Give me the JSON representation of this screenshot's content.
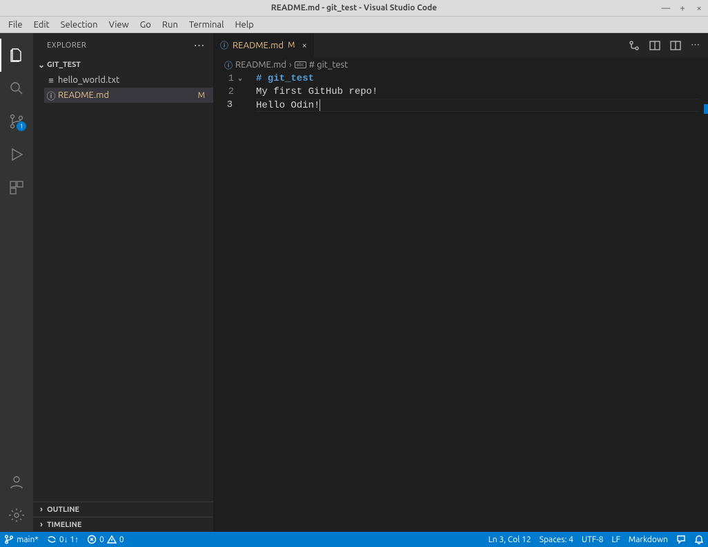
{
  "window": {
    "title": "README.md - git_test - Visual Studio Code"
  },
  "menu": {
    "items": [
      "File",
      "Edit",
      "Selection",
      "View",
      "Go",
      "Run",
      "Terminal",
      "Help"
    ]
  },
  "activity": {
    "scm_badge": "1"
  },
  "sidebar": {
    "title": "EXPLORER",
    "project": "GIT_TEST",
    "files": [
      {
        "icon": "≡",
        "name": "hello_world.txt",
        "modified": false,
        "selected": false
      },
      {
        "icon": "ⓘ",
        "name": "README.md",
        "modified": true,
        "selected": true,
        "status": "M"
      }
    ],
    "outline": "OUTLINE",
    "timeline": "TIMELINE"
  },
  "tab": {
    "name": "README.md",
    "status": "M",
    "close": "×"
  },
  "breadcrumb": {
    "file": "README.md",
    "sep": "›",
    "symbol": "# git_test"
  },
  "editor": {
    "lines": [
      {
        "n": "1",
        "cls": "md-h",
        "text": "# git_test",
        "fold": "⌄"
      },
      {
        "n": "2",
        "cls": "md-text",
        "text": "My first GitHub repo!"
      },
      {
        "n": "3",
        "cls": "md-text",
        "text": "Hello Odin!",
        "cursor": true
      }
    ]
  },
  "status": {
    "branch": "main*",
    "sync": "0↓ 1↑",
    "errors": "0",
    "warnings": "0",
    "cursor": "Ln 3, Col 12",
    "spaces": "Spaces: 4",
    "encoding": "UTF-8",
    "eol": "LF",
    "lang": "Markdown"
  }
}
